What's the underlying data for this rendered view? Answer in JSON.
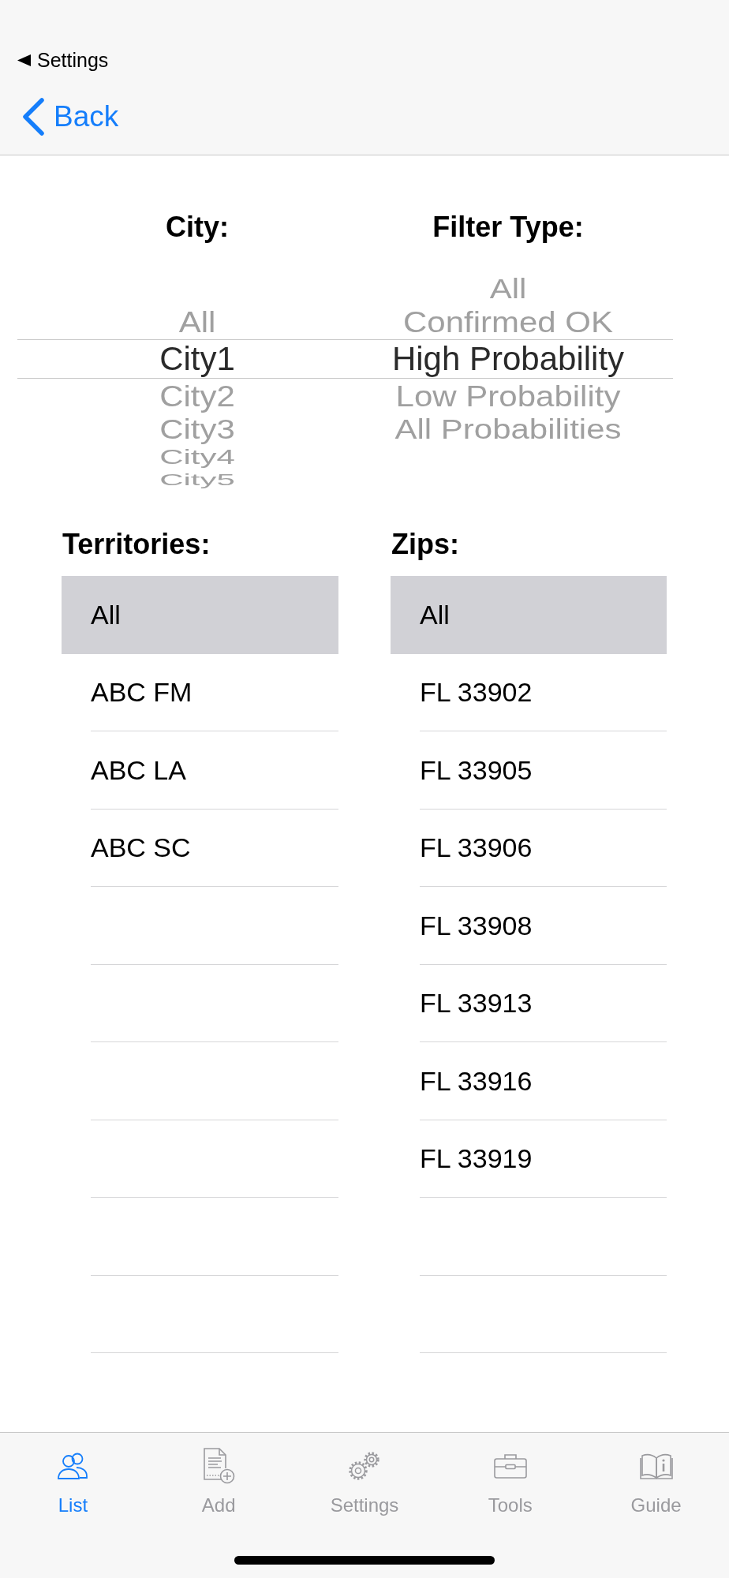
{
  "header": {
    "return_app": "Settings",
    "back": "Back"
  },
  "pickers": [
    {
      "label": "City:",
      "items": [
        {
          "text": "All",
          "selected": false
        },
        {
          "text": "City1",
          "selected": true
        },
        {
          "text": "City2",
          "selected": false
        },
        {
          "text": "City3",
          "selected": false
        },
        {
          "text": "City4",
          "selected": false
        },
        {
          "text": "City5",
          "selected": false
        }
      ]
    },
    {
      "label": "Filter Type:",
      "items": [
        {
          "text": "All",
          "selected": false
        },
        {
          "text": "Confirmed OK",
          "selected": false
        },
        {
          "text": "High Probability",
          "selected": true
        },
        {
          "text": "Low Probability",
          "selected": false
        },
        {
          "text": "All Probabilities",
          "selected": false
        }
      ]
    }
  ],
  "lists": [
    {
      "label": "Territories:",
      "items": [
        {
          "text": "All",
          "selected": true
        },
        {
          "text": "ABC FM",
          "selected": false
        },
        {
          "text": "ABC LA",
          "selected": false
        },
        {
          "text": "ABC SC",
          "selected": false
        }
      ]
    },
    {
      "label": "Zips:",
      "items": [
        {
          "text": "All",
          "selected": true
        },
        {
          "text": "FL 33902",
          "selected": false
        },
        {
          "text": "FL 33905",
          "selected": false
        },
        {
          "text": "FL 33906",
          "selected": false
        },
        {
          "text": "FL 33908",
          "selected": false
        },
        {
          "text": "FL 33913",
          "selected": false
        },
        {
          "text": "FL 33916",
          "selected": false
        },
        {
          "text": "FL 33919",
          "selected": false
        }
      ]
    }
  ],
  "tab_bar": [
    {
      "label": "List",
      "selected": true
    },
    {
      "label": "Add",
      "selected": false
    },
    {
      "label": "Settings",
      "selected": false
    },
    {
      "label": "Tools",
      "selected": false
    },
    {
      "label": "Guide",
      "selected": false
    }
  ]
}
